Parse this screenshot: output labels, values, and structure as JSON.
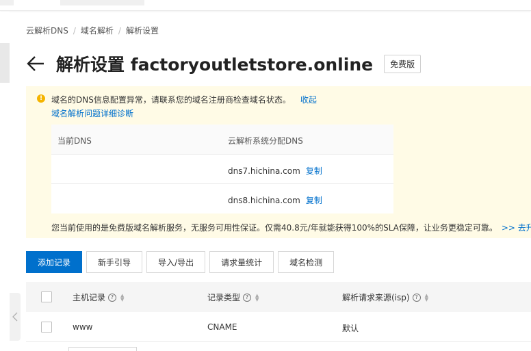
{
  "breadcrumb": {
    "items": [
      "云解析DNS",
      "域名解析",
      "解析设置"
    ],
    "separator": "/"
  },
  "header": {
    "title": "解析设置 factoryoutletstore.online",
    "badge": "免费版"
  },
  "warning": {
    "message": "域名的DNS信息配置异常，请联系您的域名注册商检查域名状态。",
    "collapse_link": "收起",
    "diagnose_link": "域名解析问题详细诊断",
    "dns_table": {
      "headers": [
        "当前DNS",
        "云解析系统分配DNS"
      ],
      "rows": [
        {
          "current": "",
          "assigned": "dns7.hichina.com",
          "action": "复制"
        },
        {
          "current": "",
          "assigned": "dns8.hichina.com",
          "action": "复制"
        }
      ]
    },
    "footer": "您当前使用的是免费版域名解析服务，无服务可用性保证。仅需40.8元/年就能获得100%的SLA保障，让业务更稳定可靠。",
    "upgrade_link": ">> 去升级"
  },
  "toolbar": {
    "add_record": "添加记录",
    "guide": "新手引导",
    "import_export": "导入/导出",
    "request_stats": "请求量统计",
    "domain_check": "域名检测"
  },
  "records": {
    "headers": [
      "主机记录",
      "记录类型",
      "解析请求来源(isp)"
    ],
    "help_glyph": "?",
    "rows": [
      {
        "host": "www",
        "type": "CNAME",
        "isp": "默认"
      }
    ]
  },
  "colors": {
    "accent": "#0070cc",
    "warning_bg": "#fffbe6",
    "warning_icon": "#f5b400"
  },
  "icons": {
    "back": "arrow-left-icon",
    "warning": "exclamation-circle-icon",
    "collapse": "chevron-left-icon"
  }
}
